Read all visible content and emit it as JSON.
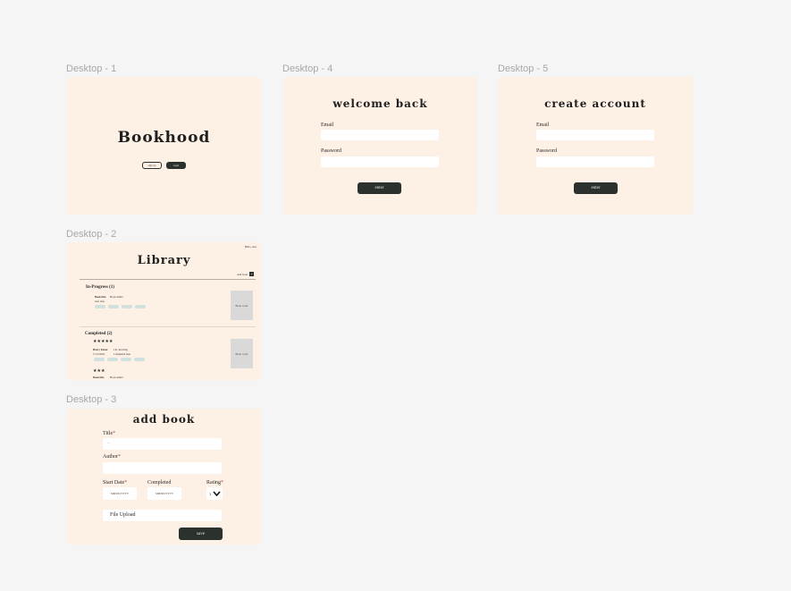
{
  "frames": {
    "d1": {
      "label": "Desktop - 1",
      "title": "Bookhood",
      "signup_label": "sign up",
      "login_label": "login"
    },
    "d4": {
      "label": "Desktop - 4",
      "title": "welcome back",
      "email_label": "Email",
      "password_label": "Password",
      "enter_label": "enter"
    },
    "d5": {
      "label": "Desktop - 5",
      "title": "create account",
      "email_label": "Email",
      "password_label": "Password",
      "enter_label": "enter"
    },
    "d2": {
      "label": "Desktop - 2",
      "title": "Library",
      "user_link": "Hello, user",
      "add_book": "Add book",
      "add_icon": "plus-icon",
      "in_progress_heading": "In-Progress (1)",
      "in_progress_book": {
        "title": "Book title",
        "author": "Book author",
        "start": "start date",
        "cover": "Book cover"
      },
      "completed_heading": "Completed (2)",
      "completed_book1": {
        "stars": "★★★★★",
        "title": "Harry Potter",
        "author": "J.K. Rowling",
        "dates": "17/12/2021",
        "completed": "Completed date",
        "cover": "Book cover"
      },
      "completed_book2": {
        "stars": "★★★",
        "title": "Book title",
        "author": "Book author"
      }
    },
    "d3": {
      "label": "Desktop - 3",
      "title": "add book",
      "title_label": "Title",
      "title_placeholder": "...",
      "author_label": "Author",
      "start_label": "Start Date",
      "start_placeholder": "MM/DD/YYYY",
      "completed_label": "Completed",
      "completed_placeholder": "MM/DD/YYYY",
      "rating_label": "Rating",
      "rating_value": "1",
      "file_upload": "File Upload",
      "save_label": "save",
      "required_mark": "*"
    }
  },
  "colors": {
    "canvas": "#f5f5f5",
    "frame": "#fdf1e5",
    "button": "#2b312d",
    "tag": "#cfe0de"
  }
}
